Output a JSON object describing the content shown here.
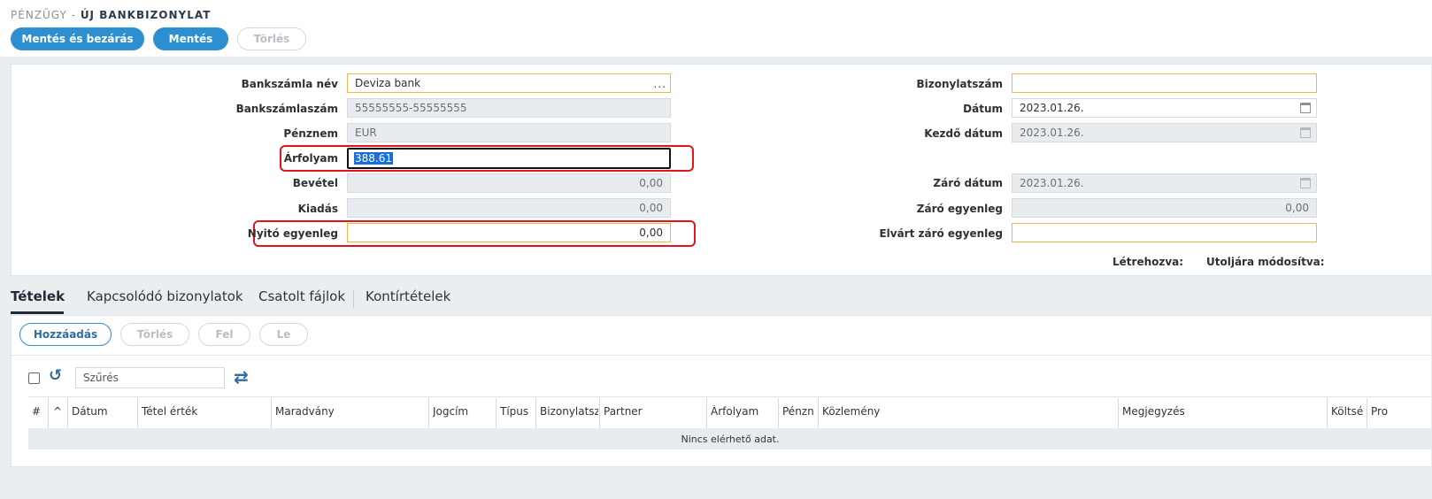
{
  "breadcrumb": {
    "prefix": "PÉNZÜGY -",
    "current": "ÚJ BANKBIZONYLAT"
  },
  "toolbar": {
    "save_close": "Mentés és bezárás",
    "save": "Mentés",
    "delete": "Törlés"
  },
  "form": {
    "left": {
      "bank_account_name": {
        "label": "Bankszámla név",
        "value": "Deviza bank",
        "dots": "..."
      },
      "bank_account_number": {
        "label": "Bankszámlaszám",
        "value": "55555555-55555555"
      },
      "currency": {
        "label": "Pénznem",
        "value": "EUR"
      },
      "rate": {
        "label": "Árfolyam",
        "value": "388.61"
      },
      "income": {
        "label": "Bevétel",
        "value": "0,00"
      },
      "expense": {
        "label": "Kiadás",
        "value": "0,00"
      },
      "opening_balance": {
        "label": "Nyitó egyenleg",
        "value": "0,00"
      }
    },
    "right": {
      "doc_number": {
        "label": "Bizonylatszám",
        "value": ""
      },
      "date": {
        "label": "Dátum",
        "value": "2023.01.26."
      },
      "start_date": {
        "label": "Kezdő dátum",
        "value": "2023.01.26."
      },
      "end_date": {
        "label": "Záró dátum",
        "value": "2023.01.26."
      },
      "closing_balance": {
        "label": "Záró egyenleg",
        "value": "0,00"
      },
      "expected_closing": {
        "label": "Elvárt záró egyenleg",
        "value": ""
      }
    },
    "meta": {
      "created": "Létrehozva:",
      "modified": "Utoljára módosítva:"
    }
  },
  "tabs": [
    "Tételek",
    "Kapcsolódó bizonylatok",
    "Csatolt fájlok",
    "Kontírtételek"
  ],
  "items_toolbar": {
    "add": "Hozzáadás",
    "delete": "Törlés",
    "up": "Fel",
    "down": "Le"
  },
  "filter": {
    "placeholder": "Szűrés"
  },
  "table": {
    "columns": [
      "#",
      "^",
      "Dátum",
      "Tétel érték",
      "Maradvány",
      "Jogcím",
      "Típus",
      "Bizonylatsz",
      "Partner",
      "Árfolyam",
      "Pénzn",
      "Közlemény",
      "Megjegyzés",
      "Költsé",
      "Pro"
    ],
    "empty_text": "Nincs elérhető adat."
  },
  "colors": {
    "primary": "#2d8fcf",
    "highlight": "#e3141b",
    "required_border": "#f0b64a"
  }
}
